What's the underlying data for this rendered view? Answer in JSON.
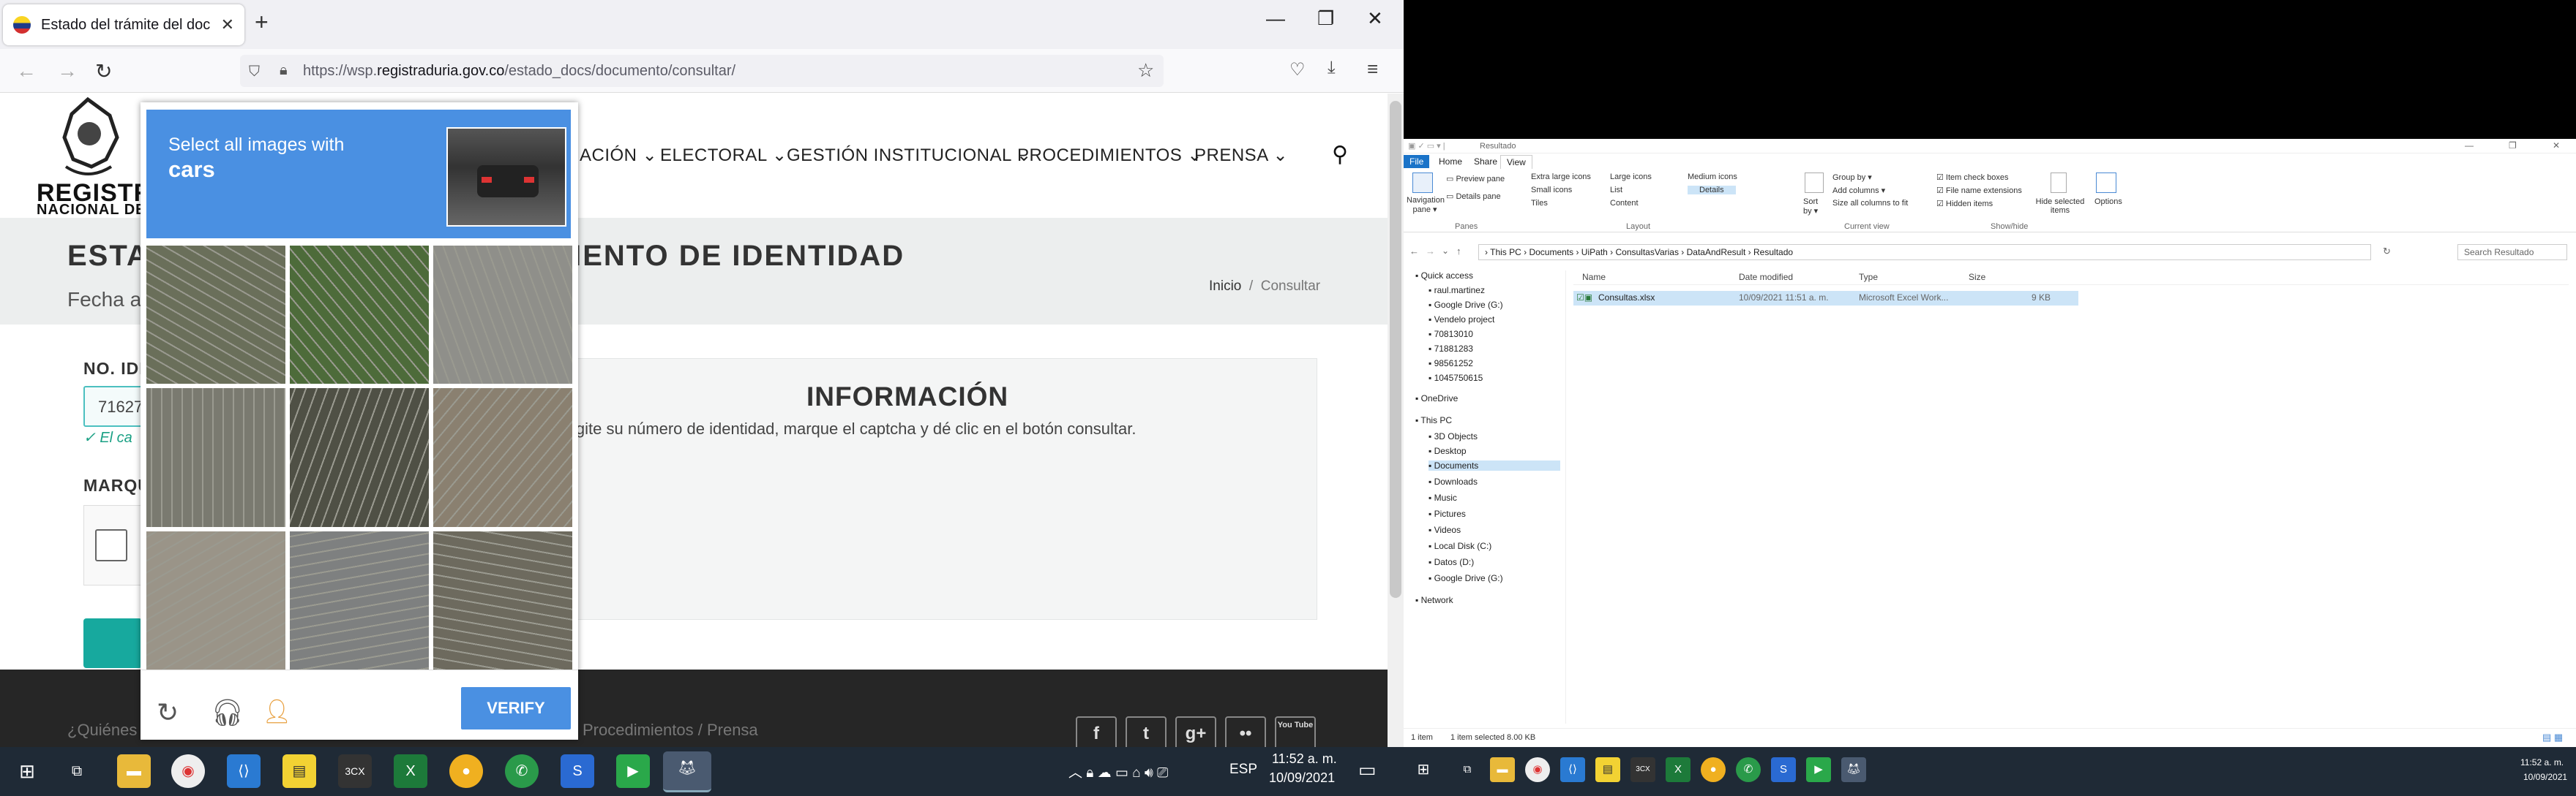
{
  "browser": {
    "tab_title": "Estado del trámite del documento",
    "url_host": "https://wsp.",
    "url_domain": "registraduria.gov.co",
    "url_path": "/estado_docs/documento/consultar/"
  },
  "site": {
    "logo_line1": "REGISTR",
    "logo_line2": "NACIONAL DEL",
    "menu": [
      "ACIÓN",
      "ELECTORAL",
      "GESTIÓN INSTITUCIONAL",
      "PROCEDIMIENTOS",
      "PRENSA"
    ],
    "title_left": "ESTA",
    "title_right": "UMENTO DE IDENTIDAD",
    "fecha": "Fecha a",
    "breadcrumb_home": "Inicio",
    "breadcrumb_sep": "/",
    "breadcrumb_current": "Consultar",
    "id_label": "NO. IDE",
    "id_value": "71627",
    "valid_text": "✓ El ca",
    "captcha_label": "MARQU",
    "info_title": "INFORMACIÓN",
    "info_text": "igite su número de identidad, marque el captcha y dé clic en el botón consultar.",
    "footer_links_left": "¿Quiénes",
    "footer_links_right": "Procedimientos   /   Prensa",
    "social": [
      "f",
      "t",
      "g+",
      "••",
      "You Tube"
    ]
  },
  "captcha": {
    "instruction": "Select all images with",
    "target": "cars",
    "verify_label": "VERIFY",
    "tiles": [
      "#6a6f5a",
      "#4d6b3a",
      "#8f8f8a",
      "#7a7a70",
      "#4f5045",
      "#8a8070",
      "#9a9488",
      "#7e8080",
      "#6d6a5e"
    ]
  },
  "taskbar_left": {
    "lang": "ESP",
    "time": "11:52 a. m.",
    "date": "10/09/2021"
  },
  "explorer": {
    "title": "Resultado",
    "tabs": [
      "File",
      "Home",
      "Share",
      "View"
    ],
    "ribbon": {
      "nav_pane": "Navigation pane ▾",
      "preview": "Preview pane",
      "details_pane": "Details pane",
      "layout_items": [
        "Extra large icons",
        "Large icons",
        "Medium icons",
        "Small icons",
        "List",
        "Details",
        "Tiles",
        "Content"
      ],
      "sort": "Sort by ▾",
      "group_by": "Group by ▾",
      "add_columns": "Add columns ▾",
      "size_all": "Size all columns to fit",
      "item_check": "Item check boxes",
      "file_ext": "File name extensions",
      "hidden": "Hidden items",
      "hide_selected": "Hide selected items",
      "options": "Options",
      "groups": [
        "Panes",
        "Layout",
        "Current view",
        "Show/hide"
      ]
    },
    "address": "›  This PC  ›  Documents  ›  UiPath  ›  ConsultasVarias  ›  DataAndResult  ›  Resultado",
    "search_placeholder": "Search Resultado",
    "nav": [
      "Quick access",
      "raul.martinez",
      "Google Drive (G:)",
      "Vendelo project",
      "70813010",
      "71881283",
      "98561252",
      "1045750615",
      "OneDrive",
      "This PC",
      "3D Objects",
      "Desktop",
      "Documents",
      "Downloads",
      "Music",
      "Pictures",
      "Videos",
      "Local Disk (C:)",
      "Datos (D:)",
      "Google Drive (G:)",
      "Network"
    ],
    "columns": [
      "Name",
      "Date modified",
      "Type",
      "Size"
    ],
    "file": {
      "name": "Consultas.xlsx",
      "date": "10/09/2021 11:51 a. m.",
      "type": "Microsoft Excel Work...",
      "size": "9 KB"
    },
    "status_items": "1 item",
    "status_selected": "1 item selected  8.00 KB"
  },
  "taskbar_right": {
    "time": "11:52 a. m.",
    "date": "10/09/2021"
  }
}
